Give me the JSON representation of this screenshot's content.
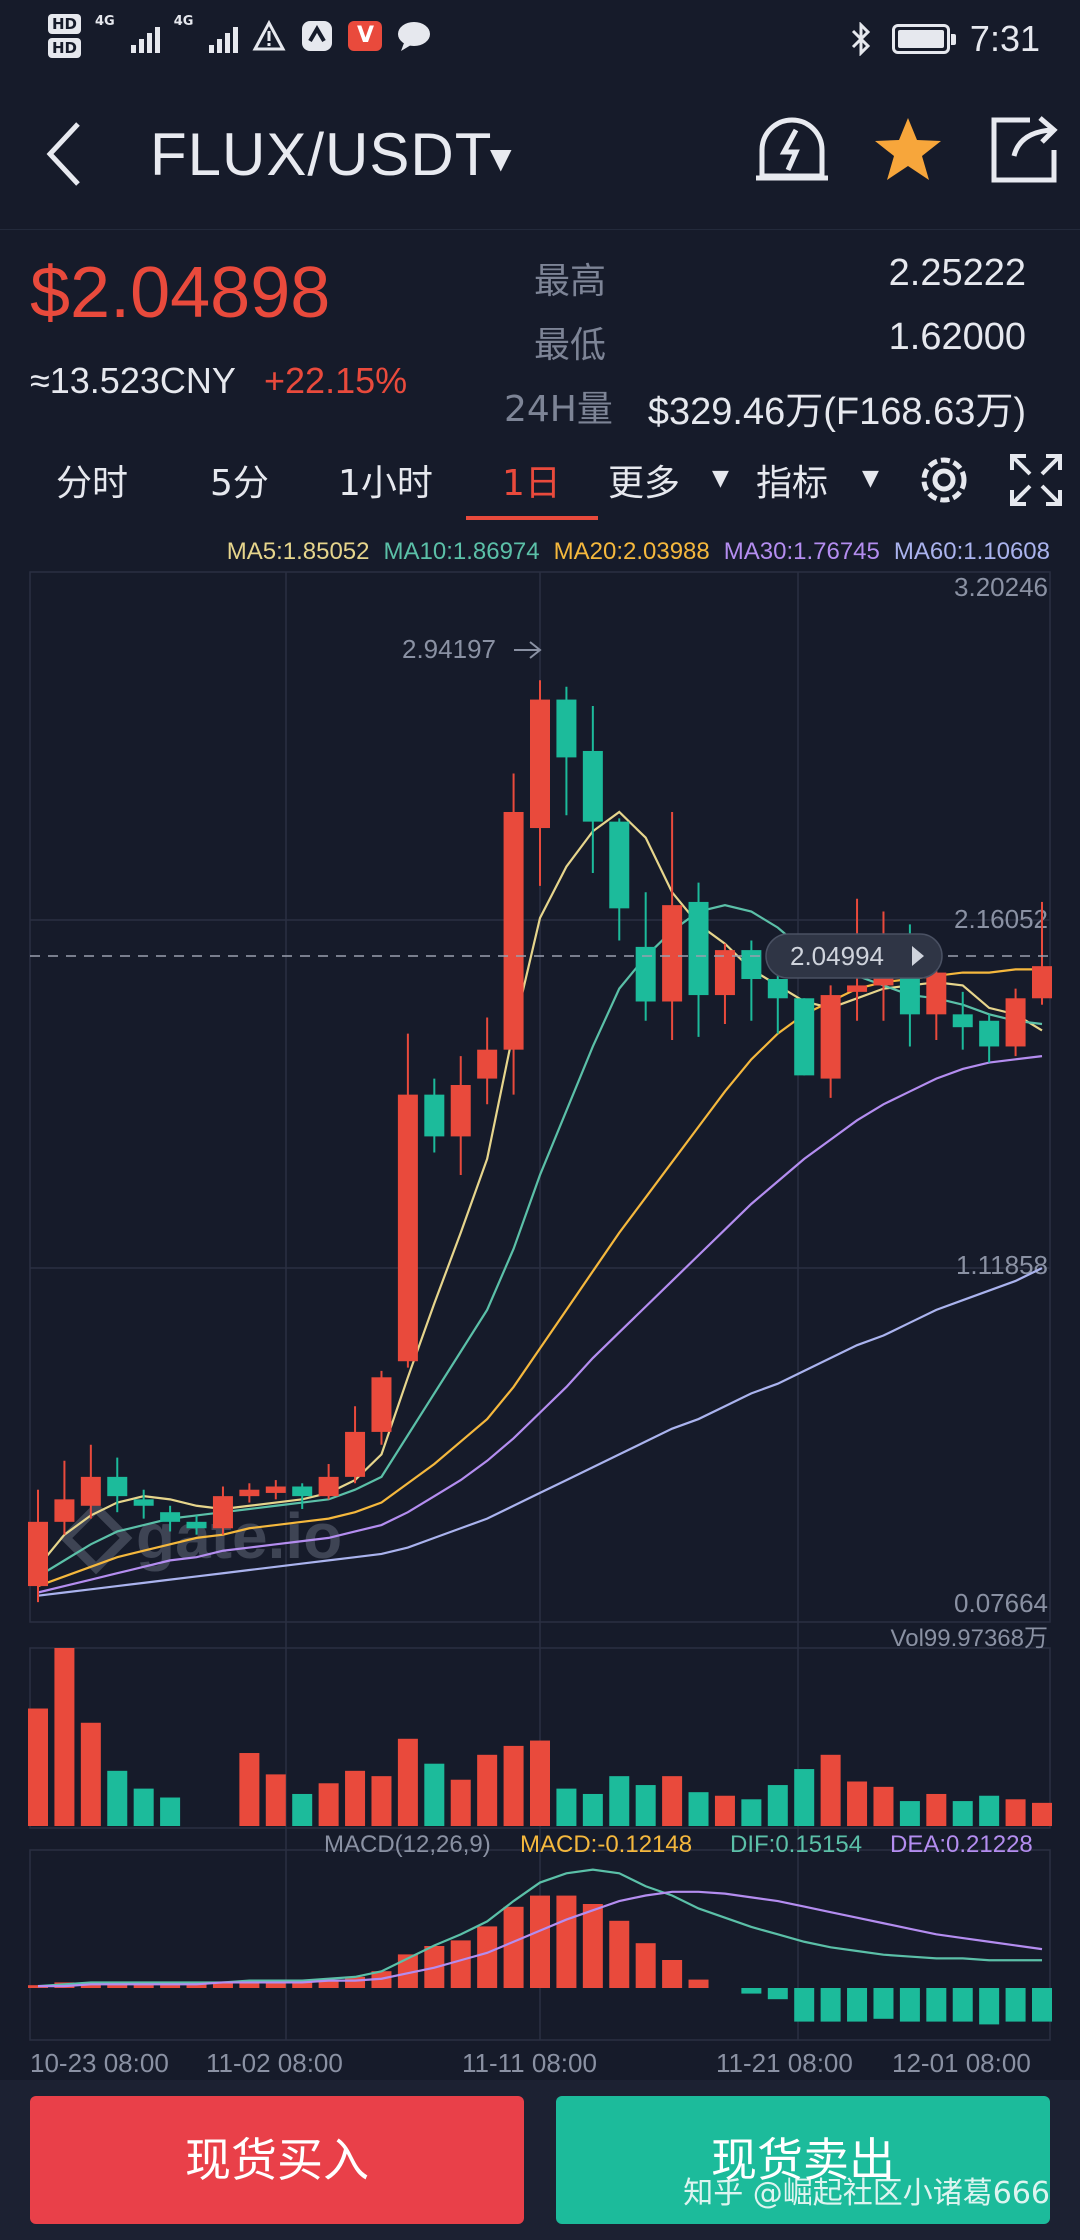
{
  "status_bar": {
    "hd_1": "HD",
    "hd_2": "HD",
    "net_1": "4G",
    "net_2": "4G",
    "time": "7:31",
    "icons": [
      "warning-icon",
      "app-icon",
      "v-app-icon",
      "chat-bubble-icon",
      "bluetooth-icon",
      "battery-icon"
    ],
    "v_app_label": "V"
  },
  "header": {
    "pair": "FLUX/USDT",
    "icons": [
      "back-icon",
      "caret-down-icon",
      "price-alert-icon",
      "favorite-star-icon",
      "share-icon"
    ],
    "star_color": "#f7a63b"
  },
  "summary": {
    "last_price": "$2.04898",
    "cny": "≈13.523CNY",
    "change": "+22.15%",
    "high_label": "最高",
    "high_value": "2.25222",
    "low_label": "最低",
    "low_value": "1.62000",
    "vol_label": "24H量",
    "vol_value": "$329.46万(F168.63万)"
  },
  "tabs": {
    "items": [
      "分时",
      "5分",
      "1小时",
      "1日",
      "更多",
      "指标"
    ],
    "active": "1日",
    "icons": [
      "settings-gear-icon",
      "fullscreen-icon"
    ]
  },
  "ma_legend": {
    "ma5": "MA5:1.85052",
    "ma10": "MA10:1.86974",
    "ma20": "MA20:2.03988",
    "ma30": "MA30:1.76745",
    "ma60": "MA60:1.10608"
  },
  "chart_labels": {
    "y_max": "3.20246",
    "y_mid": "2.16052",
    "y_low": "1.11858",
    "y_min": "0.07664",
    "peak": "2.94197",
    "current": "2.04994",
    "vol": "Vol99.97368万",
    "macd": "MACD(12,26,9)",
    "macd_value": "MACD:-0.12148",
    "dif": "DIF:0.15154",
    "dea": "DEA:0.21228",
    "x_ticks": [
      "10-23 08:00",
      "11-02 08:00",
      "11-11 08:00",
      "11-21 08:00",
      "12-01 08:00"
    ],
    "logo": "gate.io"
  },
  "colors": {
    "up": "#e94a3c",
    "down": "#1cbb9b",
    "ma5": "#e6d58c",
    "ma10": "#5bc0a8",
    "ma20": "#f5b83d",
    "ma30": "#b48df0",
    "ma60": "#aab3ee"
  },
  "chart_data": {
    "type": "candlestick",
    "x_ticks": [
      "10-23 08:00",
      "11-02 08:00",
      "11-11 08:00",
      "11-21 08:00",
      "12-01 08:00"
    ],
    "y_ticks": [
      3.20246,
      2.16052,
      1.11858,
      0.07664
    ],
    "candles": [
      {
        "o": 0.12,
        "c": 0.32,
        "h": 0.42,
        "l": 0.07
      },
      {
        "o": 0.32,
        "c": 0.39,
        "h": 0.51,
        "l": 0.28
      },
      {
        "o": 0.37,
        "c": 0.46,
        "h": 0.56,
        "l": 0.33
      },
      {
        "o": 0.46,
        "c": 0.4,
        "h": 0.52,
        "l": 0.35
      },
      {
        "o": 0.39,
        "c": 0.37,
        "h": 0.42,
        "l": 0.33
      },
      {
        "o": 0.35,
        "c": 0.32,
        "h": 0.37,
        "l": 0.29
      },
      {
        "o": 0.32,
        "c": 0.3,
        "h": 0.34,
        "l": 0.28
      },
      {
        "o": 0.3,
        "c": 0.4,
        "h": 0.43,
        "l": 0.28
      },
      {
        "o": 0.4,
        "c": 0.42,
        "h": 0.44,
        "l": 0.38
      },
      {
        "o": 0.41,
        "c": 0.43,
        "h": 0.45,
        "l": 0.39
      },
      {
        "o": 0.43,
        "c": 0.4,
        "h": 0.44,
        "l": 0.36
      },
      {
        "o": 0.4,
        "c": 0.46,
        "h": 0.5,
        "l": 0.39
      },
      {
        "o": 0.46,
        "c": 0.6,
        "h": 0.68,
        "l": 0.44
      },
      {
        "o": 0.6,
        "c": 0.77,
        "h": 0.79,
        "l": 0.56
      },
      {
        "o": 0.82,
        "c": 1.65,
        "h": 1.84,
        "l": 0.8
      },
      {
        "o": 1.65,
        "c": 1.52,
        "h": 1.7,
        "l": 1.47
      },
      {
        "o": 1.52,
        "c": 1.68,
        "h": 1.77,
        "l": 1.4
      },
      {
        "o": 1.7,
        "c": 1.79,
        "h": 1.89,
        "l": 1.62
      },
      {
        "o": 1.79,
        "c": 2.53,
        "h": 2.65,
        "l": 1.65
      },
      {
        "o": 2.48,
        "c": 2.88,
        "h": 2.94,
        "l": 2.3
      },
      {
        "o": 2.88,
        "c": 2.7,
        "h": 2.92,
        "l": 2.52
      },
      {
        "o": 2.72,
        "c": 2.5,
        "h": 2.86,
        "l": 2.34
      },
      {
        "o": 2.5,
        "c": 2.23,
        "h": 2.51,
        "l": 2.13
      },
      {
        "o": 2.11,
        "c": 1.94,
        "h": 2.28,
        "l": 1.88
      },
      {
        "o": 1.94,
        "c": 2.24,
        "h": 2.53,
        "l": 1.82
      },
      {
        "o": 2.25,
        "c": 1.96,
        "h": 2.31,
        "l": 1.83
      },
      {
        "o": 1.96,
        "c": 2.1,
        "h": 2.12,
        "l": 1.87
      },
      {
        "o": 2.1,
        "c": 2.01,
        "h": 2.13,
        "l": 1.88
      },
      {
        "o": 2.01,
        "c": 1.95,
        "h": 2.07,
        "l": 1.84
      },
      {
        "o": 1.95,
        "c": 1.71,
        "h": 1.95,
        "l": 1.71
      },
      {
        "o": 1.7,
        "c": 1.96,
        "h": 1.99,
        "l": 1.64
      },
      {
        "o": 1.97,
        "c": 1.99,
        "h": 2.26,
        "l": 1.88
      },
      {
        "o": 1.99,
        "c": 2.15,
        "h": 2.22,
        "l": 1.88
      },
      {
        "o": 2.15,
        "c": 1.9,
        "h": 2.18,
        "l": 1.8
      },
      {
        "o": 1.9,
        "c": 2.03,
        "h": 2.05,
        "l": 1.82
      },
      {
        "o": 1.9,
        "c": 1.86,
        "h": 1.97,
        "l": 1.79
      },
      {
        "o": 1.88,
        "c": 1.8,
        "h": 1.9,
        "l": 1.75
      },
      {
        "o": 1.8,
        "c": 1.95,
        "h": 1.98,
        "l": 1.77
      },
      {
        "o": 1.95,
        "c": 2.05,
        "h": 2.25,
        "l": 1.93
      }
    ],
    "ma_lines": {
      "MA5": [
        0.18,
        0.28,
        0.34,
        0.38,
        0.4,
        0.39,
        0.37,
        0.36,
        0.37,
        0.38,
        0.39,
        0.41,
        0.45,
        0.53,
        0.77,
        1.0,
        1.22,
        1.45,
        1.85,
        2.2,
        2.36,
        2.47,
        2.53,
        2.45,
        2.28,
        2.18,
        2.12,
        2.04,
        1.99,
        1.94,
        1.92,
        1.95,
        1.98,
        1.99,
        2.0,
        1.99,
        1.92,
        1.9,
        1.85
      ],
      "MA10": [
        0.15,
        0.2,
        0.25,
        0.29,
        0.31,
        0.33,
        0.34,
        0.35,
        0.36,
        0.37,
        0.38,
        0.39,
        0.42,
        0.46,
        0.59,
        0.72,
        0.85,
        0.98,
        1.17,
        1.4,
        1.6,
        1.8,
        1.98,
        2.08,
        2.16,
        2.22,
        2.24,
        2.22,
        2.17,
        2.1,
        2.05,
        2.02,
        1.99,
        1.96,
        1.95,
        1.93,
        1.9,
        1.88,
        1.87
      ],
      "MA20": [
        0.12,
        0.15,
        0.18,
        0.21,
        0.23,
        0.25,
        0.27,
        0.28,
        0.3,
        0.31,
        0.32,
        0.33,
        0.35,
        0.38,
        0.44,
        0.5,
        0.57,
        0.64,
        0.74,
        0.86,
        0.98,
        1.1,
        1.22,
        1.33,
        1.44,
        1.55,
        1.66,
        1.76,
        1.84,
        1.9,
        1.94,
        1.98,
        2.0,
        2.01,
        2.02,
        2.03,
        2.03,
        2.04,
        2.04
      ],
      "MA30": [
        0.1,
        0.12,
        0.14,
        0.16,
        0.18,
        0.2,
        0.21,
        0.23,
        0.24,
        0.25,
        0.26,
        0.27,
        0.29,
        0.31,
        0.35,
        0.4,
        0.45,
        0.51,
        0.58,
        0.66,
        0.74,
        0.83,
        0.91,
        0.99,
        1.07,
        1.15,
        1.23,
        1.31,
        1.38,
        1.45,
        1.51,
        1.57,
        1.62,
        1.66,
        1.7,
        1.73,
        1.75,
        1.76,
        1.77
      ],
      "MA60": [
        0.09,
        0.1,
        0.11,
        0.12,
        0.13,
        0.14,
        0.15,
        0.16,
        0.17,
        0.18,
        0.19,
        0.2,
        0.21,
        0.22,
        0.24,
        0.27,
        0.3,
        0.33,
        0.37,
        0.41,
        0.45,
        0.49,
        0.53,
        0.57,
        0.61,
        0.64,
        0.68,
        0.72,
        0.75,
        0.79,
        0.83,
        0.87,
        0.9,
        0.94,
        0.98,
        1.01,
        1.04,
        1.07,
        1.11
      ]
    },
    "volume": [
      0.66,
      1.0,
      0.58,
      0.31,
      0.21,
      0.16,
      0.0,
      0.0,
      0.41,
      0.29,
      0.18,
      0.24,
      0.31,
      0.28,
      0.49,
      0.35,
      0.26,
      0.4,
      0.45,
      0.48,
      0.21,
      0.18,
      0.28,
      0.23,
      0.28,
      0.19,
      0.17,
      0.15,
      0.23,
      0.32,
      0.4,
      0.25,
      0.22,
      0.14,
      0.18,
      0.14,
      0.17,
      0.15,
      0.13
    ],
    "macd_hist": [
      0.01,
      0.02,
      0.02,
      0.02,
      0.02,
      0.02,
      0.02,
      0.02,
      0.02,
      0.02,
      0.02,
      0.03,
      0.04,
      0.06,
      0.12,
      0.15,
      0.17,
      0.22,
      0.29,
      0.33,
      0.33,
      0.3,
      0.24,
      0.16,
      0.1,
      0.03,
      0.0,
      -0.02,
      -0.04,
      -0.12,
      -0.12,
      -0.12,
      -0.11,
      -0.12,
      -0.12,
      -0.12,
      -0.13,
      -0.12,
      -0.12
    ],
    "dif": [
      0.01,
      0.02,
      0.03,
      0.03,
      0.03,
      0.03,
      0.03,
      0.03,
      0.04,
      0.04,
      0.04,
      0.05,
      0.06,
      0.09,
      0.16,
      0.23,
      0.29,
      0.36,
      0.47,
      0.57,
      0.62,
      0.64,
      0.62,
      0.55,
      0.5,
      0.43,
      0.38,
      0.33,
      0.29,
      0.25,
      0.22,
      0.2,
      0.18,
      0.17,
      0.16,
      0.16,
      0.15,
      0.15,
      0.15
    ],
    "dea": [
      0.01,
      0.01,
      0.02,
      0.02,
      0.02,
      0.02,
      0.02,
      0.03,
      0.03,
      0.03,
      0.03,
      0.04,
      0.04,
      0.05,
      0.08,
      0.11,
      0.15,
      0.19,
      0.25,
      0.31,
      0.37,
      0.42,
      0.47,
      0.5,
      0.52,
      0.52,
      0.51,
      0.49,
      0.47,
      0.44,
      0.41,
      0.38,
      0.35,
      0.32,
      0.29,
      0.27,
      0.25,
      0.23,
      0.21
    ]
  }
}
